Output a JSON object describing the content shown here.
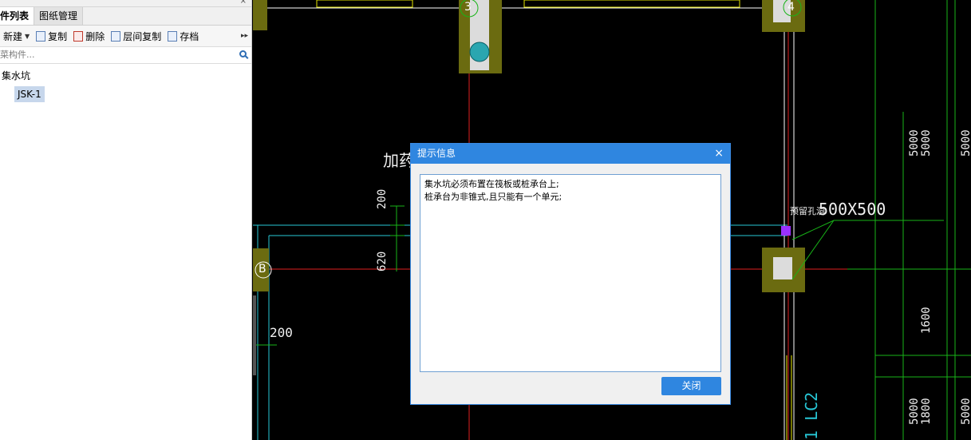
{
  "panel": {
    "close_glyph": "×",
    "tabs": [
      {
        "label": "件列表",
        "active": true
      },
      {
        "label": "图纸管理",
        "active": false
      }
    ],
    "toolbar": {
      "new_label": "新建",
      "copy_label": "复制",
      "delete_label": "删除",
      "floor_copy_label": "层间复制",
      "archive_label": "存档",
      "more_glyph": "▸▸"
    },
    "search": {
      "placeholder": "菜构件..."
    },
    "tree": {
      "category": "集水坑",
      "items": [
        "JSK-1"
      ]
    }
  },
  "cad": {
    "axis_labels": [
      "3",
      "4",
      "B"
    ],
    "dims": [
      "200",
      "620",
      "200",
      "5000",
      "5000",
      "5000",
      "1600",
      "5000",
      "1800",
      "5000"
    ],
    "text_jia": "加药",
    "text_reserve": "预留孔洞",
    "text_size": "500X500",
    "text_column": "1 LC2"
  },
  "dialog": {
    "title": "提示信息",
    "close_glyph": "×",
    "message_lines": [
      "集水坑必须布置在筏板或桩承台上;",
      "桩承台为非锥式,且只能有一个单元;"
    ],
    "ok_label": "关闭"
  },
  "colors": {
    "dialog_accent": "#2f86e0",
    "cad_background": "#000000",
    "column_fill": "#6b6b10",
    "red_axis": "#e02020",
    "cyan_line": "#27c7d6",
    "green_line": "#18b418"
  }
}
